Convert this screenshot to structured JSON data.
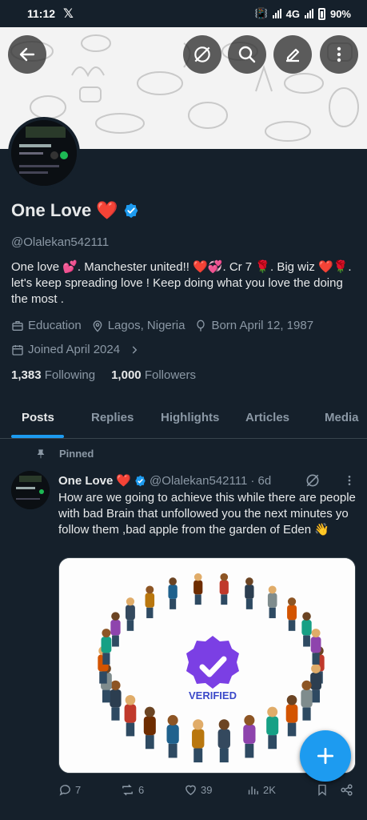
{
  "status_bar": {
    "time": "11:12",
    "x_logo": "𝕏",
    "network": "4G",
    "battery": "90%"
  },
  "profile": {
    "name": "One Love",
    "name_emoji": "❤️",
    "handle": "@Olalekan542111",
    "bio": "One love 💕. Manchester united!! ❤️💞. Cr 7 🌹. Big wiz ❤️🌹. let's keep spreading love ! Keep doing what you love the doing the most .",
    "category": "Education",
    "location": "Lagos, Nigeria",
    "born": "Born April 12, 1987",
    "joined": "Joined April 2024",
    "following_count": "1,383",
    "following_label": "Following",
    "followers_count": "1,000",
    "followers_label": "Followers"
  },
  "tabs": [
    "Posts",
    "Replies",
    "Highlights",
    "Articles",
    "Media"
  ],
  "post": {
    "pinned_label": "Pinned",
    "name": "One Love",
    "name_emoji": "❤️",
    "handle": "@Olalekan542111",
    "time": "· 6d",
    "text": "How are we going to achieve this while there are people with bad Brain that unfollowed you the next minutes yo follow them ,bad apple from the garden of Eden 👋",
    "image_badge_text": "VERIFIED",
    "replies": "7",
    "reposts": "6",
    "likes": "39",
    "views": "2K"
  },
  "colors": {
    "accent": "#1d9bf0",
    "background": "#15202b",
    "verified_purple": "#7b3fe4"
  },
  "icons": [
    "back-icon",
    "grok-icon",
    "search-icon",
    "edit-icon",
    "more-icon",
    "briefcase-icon",
    "location-icon",
    "balloon-icon",
    "calendar-icon",
    "pin-icon",
    "verified-icon",
    "reply-icon",
    "repost-icon",
    "like-icon",
    "views-icon",
    "bookmark-icon",
    "share-icon",
    "plus-icon"
  ]
}
